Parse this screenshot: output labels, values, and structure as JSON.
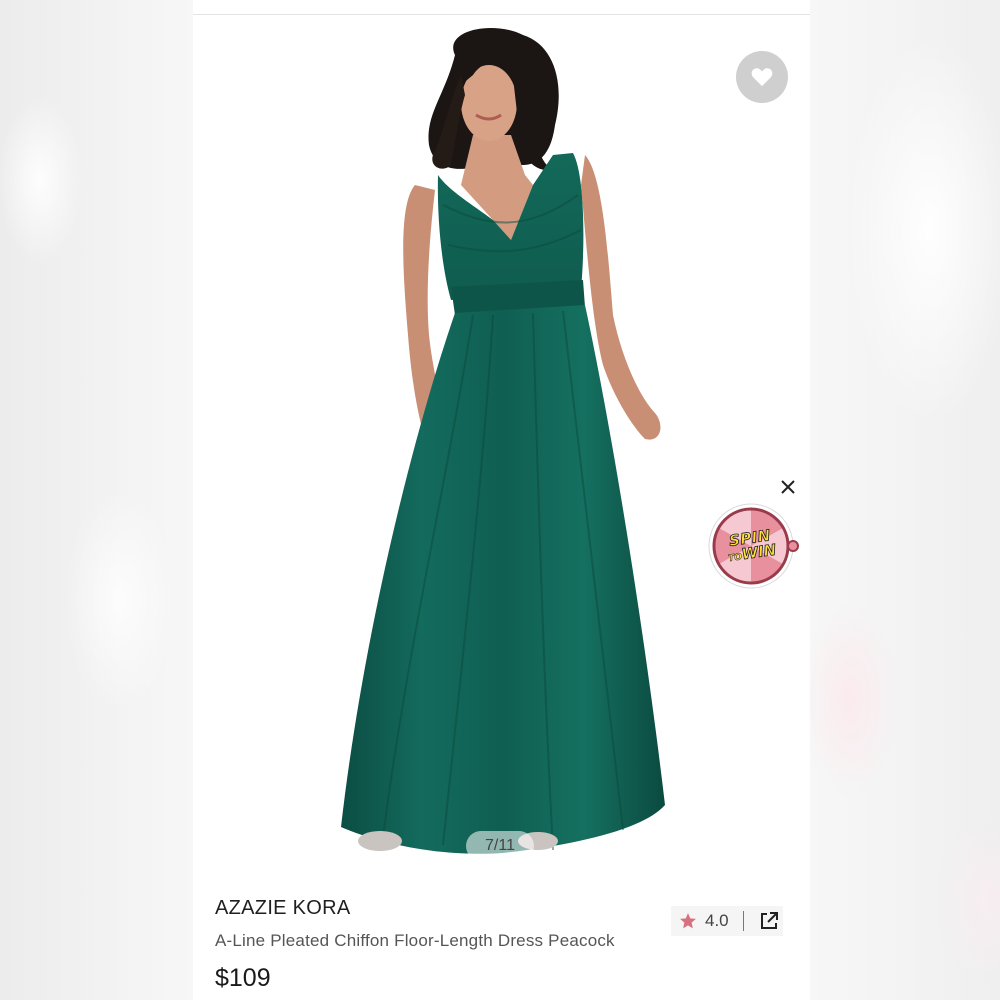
{
  "product": {
    "brand": "AZAZIE KORA",
    "subtitle": "A-Line Pleated Chiffon Floor-Length Dress Peacock",
    "price": "$109",
    "rating": "4.0"
  },
  "gallery": {
    "counter": "7/11"
  },
  "promo": {
    "line1": "SPIN",
    "line2_small": "TO",
    "line2": "WIN"
  },
  "icons": {
    "favorite": "heart-icon",
    "close": "close-icon",
    "rating": "star-icon",
    "share": "share-external-icon"
  },
  "colors": {
    "dress": "#0f5b4f",
    "favorite_bg": "#cfcfcf",
    "star": "#d9707f",
    "text_dark": "#1f1f1f",
    "text_muted": "#555555"
  }
}
